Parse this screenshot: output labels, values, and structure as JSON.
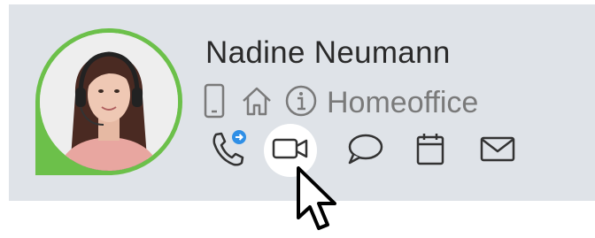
{
  "contact": {
    "name": "Nadine Neumann",
    "status": "Homeoffice",
    "presence_color": "#6cc04a"
  },
  "status_icons": [
    "mobile-phone-icon",
    "home-icon",
    "info-icon"
  ],
  "actions": [
    {
      "icon": "phone-forward-icon",
      "badge_color": "#2f8fe6"
    },
    {
      "icon": "video-camera-icon",
      "active": true
    },
    {
      "icon": "chat-bubble-icon"
    },
    {
      "icon": "calendar-icon"
    },
    {
      "icon": "mail-icon"
    }
  ]
}
